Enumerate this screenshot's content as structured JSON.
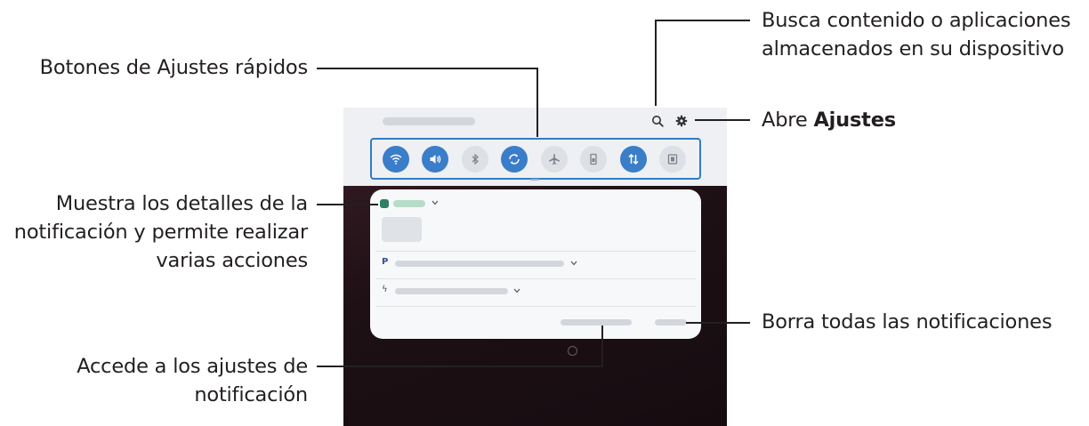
{
  "callouts": {
    "search": [
      "Busca contenido o aplicaciones",
      "almacenados en su dispositivo"
    ],
    "quick_settings": "Botones de Ajustes rápidos",
    "settings_prefix": "Abre ",
    "settings_bold": "Ajustes",
    "details": [
      "Muestra los detalles de la",
      "notificación y permite realizar",
      "varias acciones"
    ],
    "clear": "Borra todas las notificaciones",
    "notif_settings": [
      "Accede a los ajustes de",
      "notificación"
    ]
  },
  "quick_settings_buttons": [
    {
      "name": "wifi",
      "state": "on"
    },
    {
      "name": "sound",
      "state": "on"
    },
    {
      "name": "bluetooth",
      "state": "off"
    },
    {
      "name": "auto-rotate",
      "state": "on"
    },
    {
      "name": "airplane-mode",
      "state": "off"
    },
    {
      "name": "flashlight",
      "state": "off"
    },
    {
      "name": "mobile-data",
      "state": "on"
    },
    {
      "name": "power-saving",
      "state": "off"
    }
  ],
  "colors": {
    "accent": "#2f7dc4",
    "button_on": "#3a7dc9",
    "button_off": "#dde1e6",
    "wallpaper": "#1e1015",
    "line": "#231f20"
  },
  "icons": {
    "search": "search-icon",
    "settings": "gear-icon",
    "expand": "chevron-down-icon",
    "home": "home-circle-icon"
  }
}
